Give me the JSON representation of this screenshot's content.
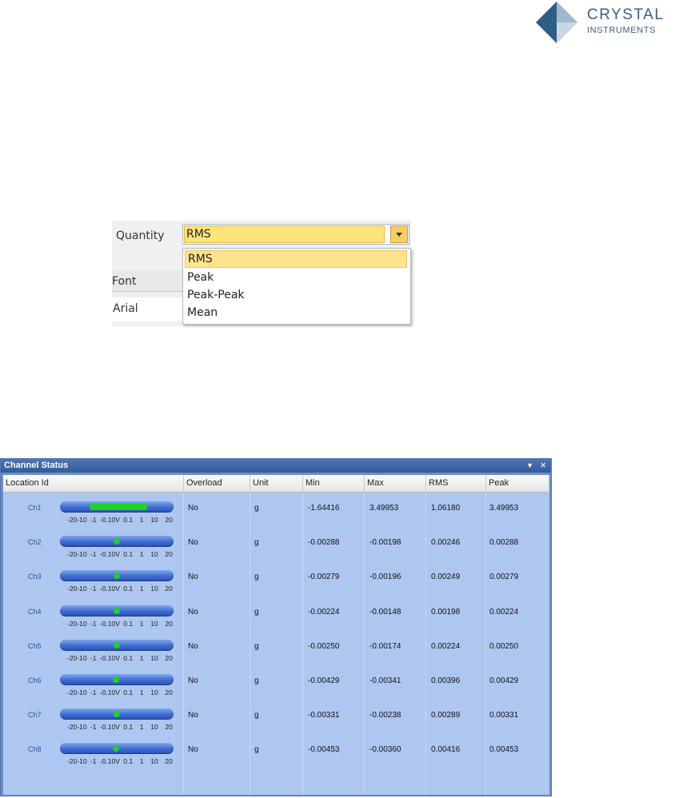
{
  "logo": {
    "name": "CRYSTAL",
    "sub": "INSTRUMENTS"
  },
  "property": {
    "label": "Quantity",
    "value": "RMS",
    "options": [
      "RMS",
      "Peak",
      "Peak-Peak",
      "Mean"
    ],
    "font_label": "Font",
    "font_value": "Arial"
  },
  "panel": {
    "title": "Channel Status",
    "menu_icon": "dropdown-arrow-icon",
    "close_icon": "close-icon",
    "columns": [
      "Location Id",
      "Overload",
      "Unit",
      "Min",
      "Max",
      "RMS",
      "Peak"
    ],
    "scale_text": "-20-10 -1 -0.10V 0.1  1  10  20",
    "indicator_color": "#1fd12a",
    "rows": [
      {
        "ch": "Ch1",
        "overload": "No",
        "unit": "g",
        "min": "-1.64416",
        "max": "3.49953",
        "rms": "1.06180",
        "peak": "3.49953",
        "range": [
          -1.64416,
          3.49953
        ]
      },
      {
        "ch": "Ch2",
        "overload": "No",
        "unit": "g",
        "min": "-0.00288",
        "max": "-0.00198",
        "rms": "0.00246",
        "peak": "0.00288",
        "range": [
          -0.00288,
          -0.00198
        ]
      },
      {
        "ch": "Ch3",
        "overload": "No",
        "unit": "g",
        "min": "-0.00279",
        "max": "-0.00196",
        "rms": "0.00249",
        "peak": "0.00279",
        "range": [
          -0.00279,
          -0.00196
        ]
      },
      {
        "ch": "Ch4",
        "overload": "No",
        "unit": "g",
        "min": "-0.00224",
        "max": "-0.00148",
        "rms": "0.00198",
        "peak": "0.00224",
        "range": [
          -0.00224,
          -0.00148
        ]
      },
      {
        "ch": "Ch5",
        "overload": "No",
        "unit": "g",
        "min": "-0.00250",
        "max": "-0.00174",
        "rms": "0.00224",
        "peak": "0.00250",
        "range": [
          -0.0025,
          -0.00174
        ]
      },
      {
        "ch": "Ch6",
        "overload": "No",
        "unit": "g",
        "min": "-0.00429",
        "max": "-0.00341",
        "rms": "0.00396",
        "peak": "0.00429",
        "range": [
          -0.00429,
          -0.00341
        ]
      },
      {
        "ch": "Ch7",
        "overload": "No",
        "unit": "g",
        "min": "-0.00331",
        "max": "-0.00238",
        "rms": "0.00289",
        "peak": "0.00331",
        "range": [
          -0.00331,
          -0.00238
        ]
      },
      {
        "ch": "Ch8",
        "overload": "No",
        "unit": "g",
        "min": "-0.00453",
        "max": "-0.00360",
        "rms": "0.00416",
        "peak": "0.00453",
        "range": [
          -0.00453,
          -0.0036
        ]
      }
    ]
  }
}
